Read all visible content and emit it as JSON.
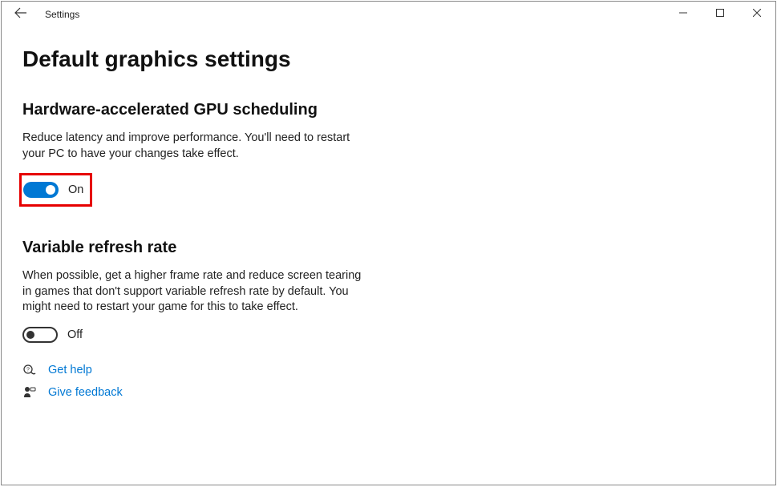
{
  "window": {
    "title": "Settings"
  },
  "page": {
    "title": "Default graphics settings"
  },
  "section1": {
    "heading": "Hardware-accelerated GPU scheduling",
    "description": "Reduce latency and improve performance. You'll need to restart your PC to have your changes take effect.",
    "toggle_state": "On"
  },
  "section2": {
    "heading": "Variable refresh rate",
    "description": "When possible, get a higher frame rate and reduce screen tearing in games that don't support variable refresh rate by default. You might need to restart your game for this to take effect.",
    "toggle_state": "Off"
  },
  "links": {
    "help": "Get help",
    "feedback": "Give feedback"
  }
}
